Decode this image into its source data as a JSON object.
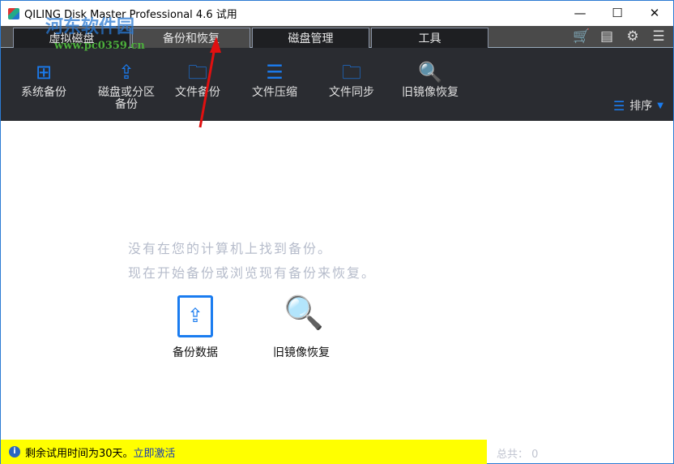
{
  "window": {
    "title": "QILING Disk Master Professional 4.6 试用",
    "minimize": "—",
    "maximize": "☐",
    "close": "✕"
  },
  "tabs": [
    {
      "label": "虚拟磁盘"
    },
    {
      "label": "备份和恢复",
      "active": true
    },
    {
      "label": "磁盘管理"
    },
    {
      "label": "工具"
    }
  ],
  "header_icons": [
    "cart-icon",
    "notebook-icon",
    "gear-icon",
    "menu-icon"
  ],
  "toolbar": {
    "items": [
      {
        "label": "系统备份",
        "icon": "⊞"
      },
      {
        "label": "磁盘或分区\n备份",
        "icon": "⇪"
      },
      {
        "label": "文件备份",
        "icon": "🗀"
      },
      {
        "label": "文件压缩",
        "icon": "☰"
      },
      {
        "label": "文件同步",
        "icon": "🗀"
      },
      {
        "label": "旧镜像恢复",
        "icon": "🔍"
      }
    ],
    "sort_label": "排序"
  },
  "main": {
    "line1": "没有在您的计算机上找到备份。",
    "line2": "现在开始备份或浏览现有备份来恢复。",
    "backup_data": "备份数据",
    "old_image_restore": "旧镜像恢复"
  },
  "status": {
    "trial": "剩余试用时间为30天。",
    "activate": "立即激活",
    "total": "总共：  0"
  },
  "watermark": {
    "cn": "河东软件园",
    "url": "www.pc0359.cn"
  },
  "colors": {
    "accent": "#1a7cf0",
    "status_bg": "#ffff00"
  }
}
